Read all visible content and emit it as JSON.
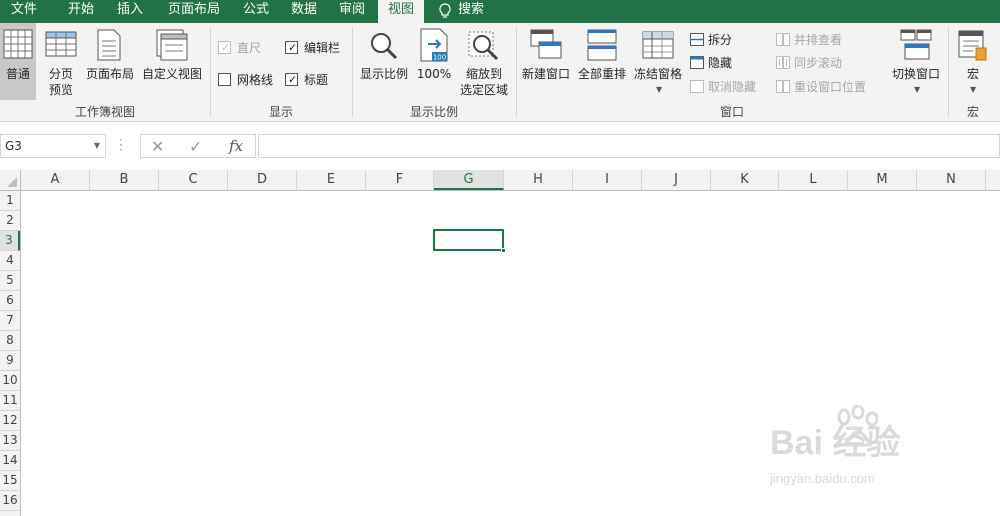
{
  "menu": {
    "tabs": [
      "文件",
      "开始",
      "插入",
      "页面布局",
      "公式",
      "数据",
      "审阅",
      "视图"
    ],
    "active": "视图",
    "search_label": "搜索"
  },
  "ribbon": {
    "workbook_views": {
      "group_label": "工作簿视图",
      "normal": "普通",
      "page_break_l1": "分页",
      "page_break_l2": "预览",
      "page_layout": "页面布局",
      "custom_views": "自定义视图"
    },
    "show": {
      "group_label": "显示",
      "ruler": "直尺",
      "formula_bar": "编辑栏",
      "gridlines": "网格线",
      "headings": "标题"
    },
    "zoom": {
      "group_label": "显示比例",
      "zoom": "显示比例",
      "hundred": "100%",
      "zoom_sel_l1": "缩放到",
      "zoom_sel_l2": "选定区域",
      "icon_text": "100"
    },
    "window": {
      "group_label": "窗口",
      "new_window": "新建窗口",
      "arrange_all": "全部重排",
      "freeze_panes": "冻结窗格",
      "split": "拆分",
      "hide": "隐藏",
      "unhide": "取消隐藏",
      "side_by_side": "并排查看",
      "sync_scroll": "同步滚动",
      "reset_position": "重设窗口位置",
      "switch_windows": "切换窗口"
    },
    "macros": {
      "group_label": "宏",
      "macros": "宏"
    }
  },
  "formula_bar": {
    "name_box": "G3",
    "cancel_glyph": "✕",
    "enter_glyph": "✓",
    "fx_label": "fx",
    "content": ""
  },
  "sheet": {
    "columns": [
      "A",
      "B",
      "C",
      "D",
      "E",
      "F",
      "G",
      "H",
      "I",
      "J",
      "K",
      "L",
      "M",
      "N"
    ],
    "rows": [
      "1",
      "2",
      "3",
      "4",
      "5",
      "6",
      "7",
      "8",
      "9",
      "10",
      "11",
      "12",
      "13",
      "14",
      "15",
      "16"
    ],
    "selected_column": "G",
    "selected_row": "3"
  },
  "watermark": {
    "brand": "Bai  经验",
    "url": "jingyan.baidu.com"
  },
  "colors": {
    "accent": "#217346",
    "ribbon_bg": "#f3f3f3"
  }
}
